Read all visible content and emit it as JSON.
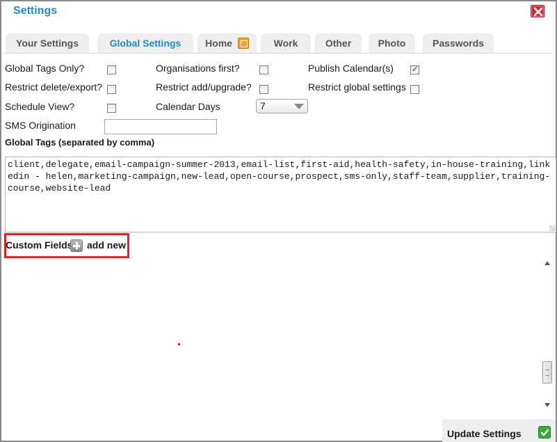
{
  "window": {
    "title": "Settings",
    "close_icon": "close-icon"
  },
  "tabs": [
    {
      "label": "Your Settings",
      "active": false
    },
    {
      "label": "Global Settings",
      "active": true
    },
    {
      "label": "Home",
      "active": false,
      "icon": "edit-icon"
    },
    {
      "label": "Work",
      "active": false
    },
    {
      "label": "Other",
      "active": false
    },
    {
      "label": "Photo",
      "active": false
    },
    {
      "label": "Passwords",
      "active": false
    }
  ],
  "options": {
    "global_tags_only": {
      "label": "Global Tags Only?",
      "checked": false
    },
    "organisations_first": {
      "label": "Organisations first?",
      "checked": false
    },
    "publish_calendar": {
      "label": "Publish Calendar(s)",
      "checked": true
    },
    "restrict_delete_export": {
      "label": "Restrict delete/export?",
      "checked": false
    },
    "restrict_add_upgrade": {
      "label": "Restrict add/upgrade?",
      "checked": false
    },
    "restrict_global_settings": {
      "label": "Restrict global settings",
      "checked": false
    },
    "schedule_view": {
      "label": "Schedule View?",
      "checked": false
    },
    "calendar_days": {
      "label": "Calendar Days",
      "value": "7"
    },
    "sms_origination": {
      "label": "SMS Origination",
      "value": ""
    }
  },
  "global_tags": {
    "label": "Global Tags (separated by comma)",
    "value": "client,delegate,email-campaign-summer-2013,email-list,first-aid,health-safety,in-house-training,linkedin - helen,marketing-campaign,new-lead,open-course,prospect,sms-only,staff-team,supplier,training-course,website-lead"
  },
  "custom_fields": {
    "label": "Custom Fields",
    "add_label": "add new",
    "highlight_color": "#e0202a"
  },
  "footer": {
    "update_label": "Update Settings"
  },
  "colors": {
    "accent": "#1f8cc8",
    "close": "#d9232d",
    "confirm": "#3aa83a"
  }
}
